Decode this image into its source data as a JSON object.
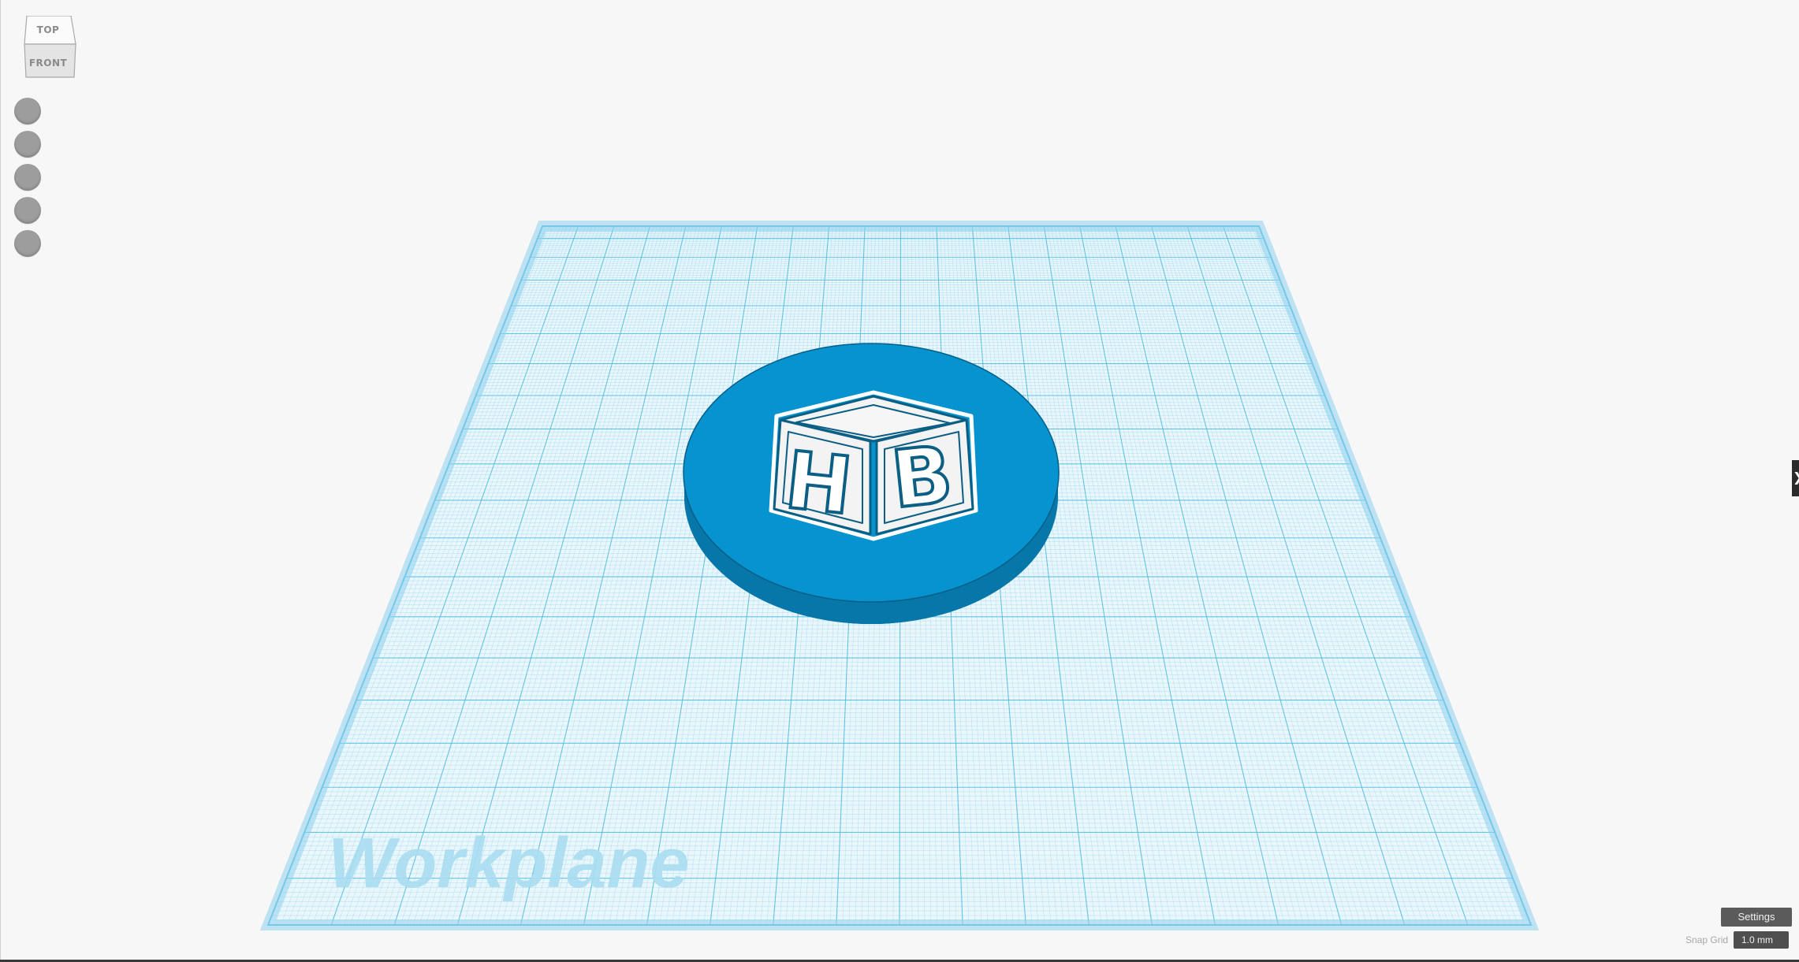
{
  "view_cube": {
    "top_label": "TOP",
    "front_label": "FRONT"
  },
  "nav_buttons": [
    {
      "icon": "home-view-icon"
    },
    {
      "icon": "fit-view-icon"
    },
    {
      "icon": "zoom-in-icon"
    },
    {
      "icon": "zoom-out-icon"
    },
    {
      "icon": "perspective-icon"
    }
  ],
  "workplane": {
    "label": "Workplane"
  },
  "model": {
    "letters": [
      "H",
      "B"
    ],
    "base_color": "#0693cf",
    "block_color": "#f3f3f3"
  },
  "settings": {
    "label": "Settings"
  },
  "snap_grid": {
    "label": "Snap Grid",
    "value": "1.0 mm"
  },
  "colors": {
    "grid_line": "#4dbbe0",
    "grid_fill": "#e9f6fb",
    "background": "#f7f7f7"
  }
}
